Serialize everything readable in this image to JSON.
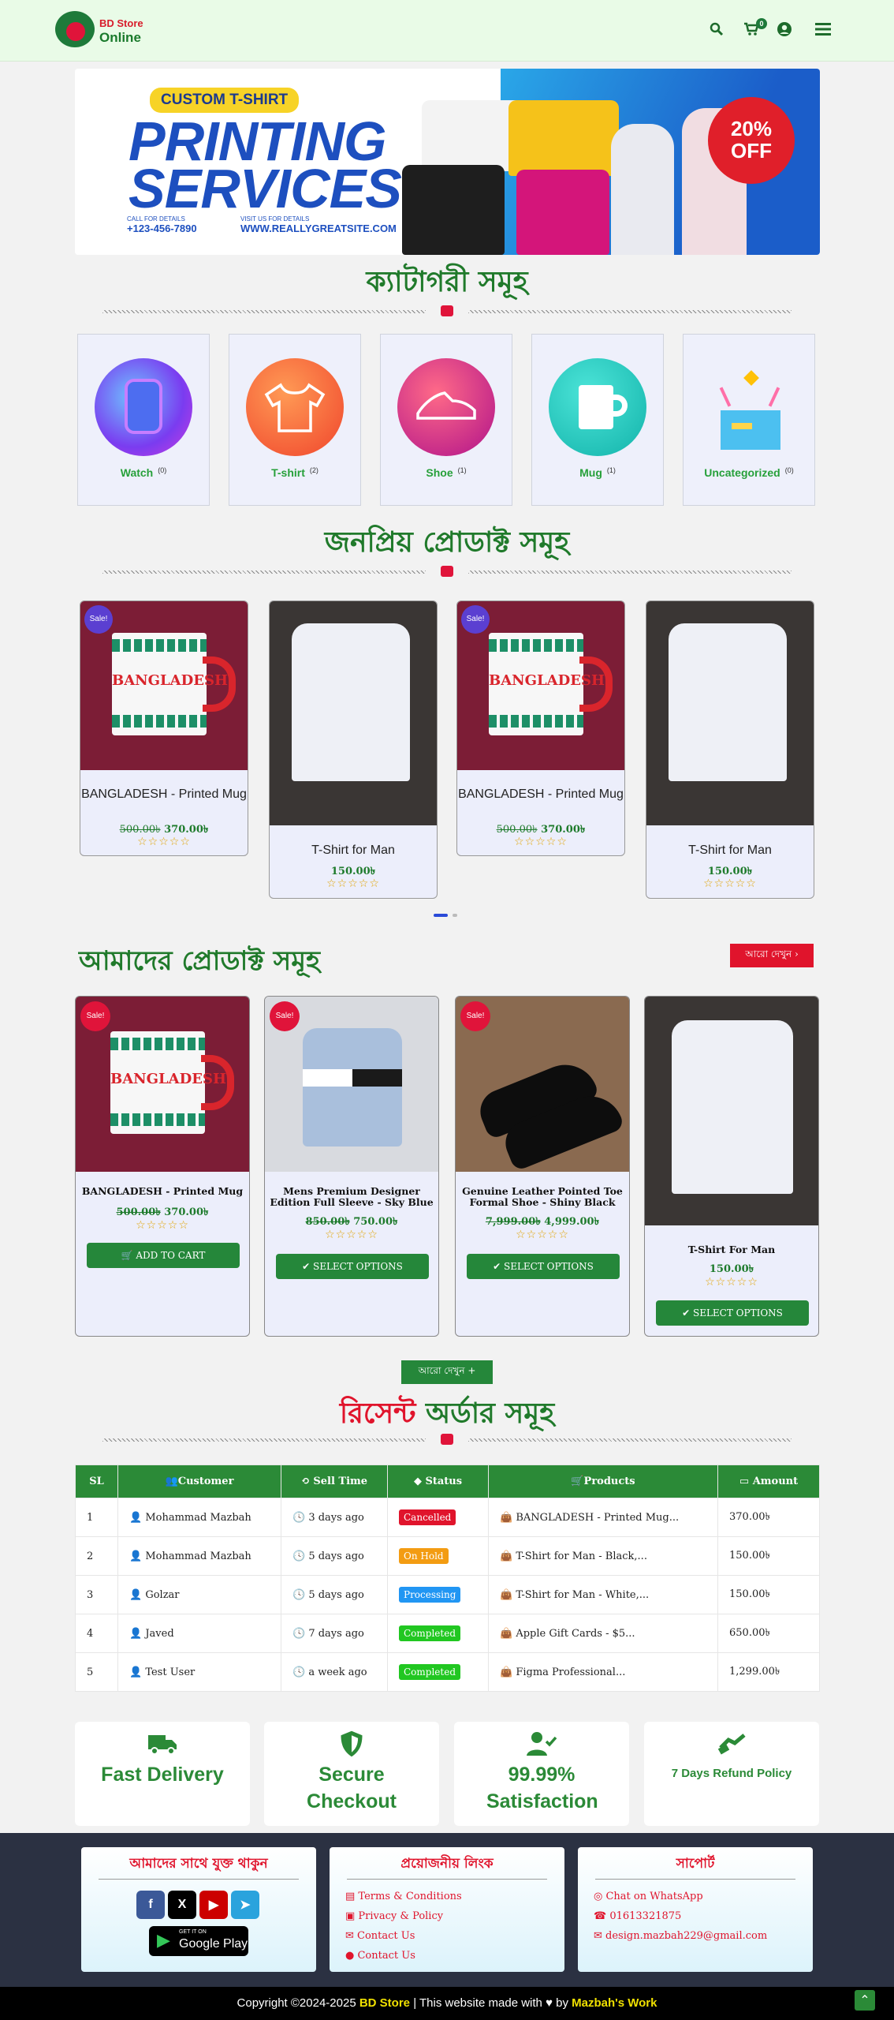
{
  "header": {
    "logo_line1": "BD Store",
    "logo_line2": "Online",
    "cart_count": "0",
    "icons": [
      "search-icon",
      "cart-icon",
      "user-icon",
      "menu-icon"
    ]
  },
  "banner": {
    "tag": "CUSTOM T-SHIRT",
    "headline_1": "PRINTING",
    "headline_2": "SERVICES",
    "call_label": "CALL FOR DETAILS",
    "phone": "+123-456-7890",
    "visit_label": "VISIT US FOR DETAILS",
    "site": "WWW.REALLYGREATSITE.COM",
    "discount_1": "20%",
    "discount_2": "OFF"
  },
  "categories": {
    "title": "ক্যাটাগরী সমূহ",
    "items": [
      {
        "name": "Watch",
        "count": "(0)"
      },
      {
        "name": "T-shirt",
        "count": "(2)"
      },
      {
        "name": "Shoe",
        "count": "(1)"
      },
      {
        "name": "Mug",
        "count": "(1)"
      },
      {
        "name": "Uncategorized",
        "count": "(0)"
      }
    ]
  },
  "popular": {
    "title": "জনপ্রিয় প্রোডাক্ট সমূহ",
    "items": [
      {
        "name": "BANGLADESH - Printed Mug",
        "old_price": "500.00৳",
        "price": "370.00৳",
        "sale": "Sale!",
        "mug_text": "BANGLADESH"
      },
      {
        "name": "T-Shirt for Man",
        "price": "150.00৳"
      },
      {
        "name": "BANGLADESH - Printed Mug",
        "old_price": "500.00৳",
        "price": "370.00৳",
        "sale": "Sale!",
        "mug_text": "BANGLADESH"
      },
      {
        "name": "T-Shirt for Man",
        "price": "150.00৳"
      }
    ],
    "stars": "☆☆☆☆☆"
  },
  "our_products": {
    "title": "আমাদের প্রোডাক্ট সমূহ",
    "more_label": "আরো দেখুন ›",
    "see_more_label": "আরো দেখুন +",
    "items": [
      {
        "name": "BANGLADESH - Printed Mug",
        "old_price": "500.00৳",
        "price": "370.00৳",
        "sale": "Sale!",
        "button": "ADD TO CART",
        "mug_text": "BANGLADESH"
      },
      {
        "name": "Mens Premium Designer Edition Full Sleeve - Sky Blue",
        "old_price": "850.00৳",
        "price": "750.00৳",
        "sale": "Sale!",
        "button": "SELECT OPTIONS"
      },
      {
        "name": "Genuine Leather Pointed Toe Formal Shoe - Shiny Black",
        "old_price": "7,999.00৳",
        "price": "4,999.00৳",
        "sale": "Sale!",
        "button": "SELECT OPTIONS"
      },
      {
        "name": "T-Shirt For Man",
        "price": "150.00৳",
        "button": "SELECT OPTIONS"
      }
    ],
    "stars": "☆☆☆☆☆"
  },
  "orders": {
    "title_red": "রিসেন্ট",
    "title_green": "অর্ডার সমূহ",
    "columns": [
      "SL",
      "Customer",
      "Sell Time",
      "Status",
      "Products",
      "Amount"
    ],
    "rows": [
      {
        "sl": "1",
        "customer": "Mohammad Mazbah",
        "time": "3 days ago",
        "status": "Cancelled",
        "status_color": "#e0142c",
        "product": "BANGLADESH - Printed Mug...",
        "amount": "370.00৳"
      },
      {
        "sl": "2",
        "customer": "Mohammad Mazbah",
        "time": "5 days ago",
        "status": "On Hold",
        "status_color": "#f39c12",
        "product": "T-Shirt for Man - Black,...",
        "amount": "150.00৳"
      },
      {
        "sl": "3",
        "customer": "Golzar",
        "time": "5 days ago",
        "status": "Processing",
        "status_color": "#2196f3",
        "product": "T-Shirt for Man - White,...",
        "amount": "150.00৳"
      },
      {
        "sl": "4",
        "customer": "Javed",
        "time": "7 days ago",
        "status": "Completed",
        "status_color": "#21c721",
        "product": "Apple Gift Cards - $5...",
        "amount": "650.00৳"
      },
      {
        "sl": "5",
        "customer": "Test User",
        "time": "a week ago",
        "status": "Completed",
        "status_color": "#21c721",
        "product": "Figma Professional...",
        "amount": "1,299.00৳"
      }
    ]
  },
  "features": [
    {
      "title": "Fast Delivery",
      "icon": "truck-icon"
    },
    {
      "title": "Secure Checkout",
      "icon": "shield-icon"
    },
    {
      "title": "99.99% Satisfaction",
      "icon": "user-check-icon"
    },
    {
      "title": "7 Days Refund Policy",
      "icon": "refund-icon"
    }
  ],
  "footer": {
    "connect_title": "আমাদের সাথে যুক্ত থাকুন",
    "links_title": "প্রয়োজনীয় লিংক",
    "support_title": "সাপোর্ট",
    "google_play_top": "GET IT ON",
    "google_play": "Google Play",
    "links": [
      "Terms & Conditions",
      "Privacy & Policy",
      "Contact Us",
      "Contact Us"
    ],
    "support": [
      "Chat on WhatsApp",
      "01613321875",
      "design.mazbah229@gmail.com"
    ],
    "copyright_pre": "Copyright ©2024-2025",
    "brand": "BD Store",
    "copyright_mid": "| This website made with",
    "by": "by",
    "author": "Mazbah's Work"
  },
  "colors": {
    "brand_green": "#207a2b",
    "accent_red": "#e0142c"
  }
}
